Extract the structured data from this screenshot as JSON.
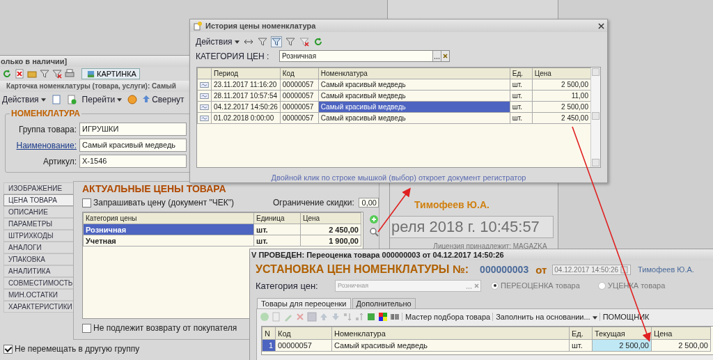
{
  "background_window": {
    "user": "Тимофеев Ю.А.",
    "clock": "реля 2018 г. 10:45:57",
    "license": "Лицензия принадлежит: MAGAZKA"
  },
  "item_window": {
    "title": "олько в наличии]",
    "picture_button": "КАРТИНКА",
    "card_title": "Карточка номенклатуры (товара, услуги): Самый",
    "menu": [
      {
        "label": "Действия",
        "kind": "dropdown"
      },
      {
        "label": "Перейти",
        "kind": "dropdown"
      },
      {
        "label": "Свернут",
        "kind": "link"
      }
    ],
    "group_title": "НОМЕНКЛАТУРА",
    "fields": [
      {
        "label": "Группа товара:",
        "value": "ИГРУШКИ",
        "link": false
      },
      {
        "label": "Наименование:",
        "value": "Самый красивый медведь",
        "link": true
      },
      {
        "label": "Артикул:",
        "value": "X-1546",
        "link": false
      }
    ],
    "tabs": [
      {
        "label": "ИЗОБРАЖЕНИЕ",
        "selected": false
      },
      {
        "label": "ЦЕНА ТОВАРА",
        "selected": true
      },
      {
        "label": "ОПИСАНИЕ",
        "selected": false
      },
      {
        "label": "ПАРАМЕТРЫ",
        "selected": false
      },
      {
        "label": "ШТРИХКОДЫ",
        "selected": false
      },
      {
        "label": "АНАЛОГИ",
        "selected": false
      },
      {
        "label": "УПАКОВКА",
        "selected": false
      },
      {
        "label": "АНАЛИТИКА",
        "selected": false
      },
      {
        "label": "СОВМЕСТИМОСТЬ",
        "selected": false
      },
      {
        "label": "МИН.ОСТАТКИ",
        "selected": false
      },
      {
        "label": "ХАРАКТЕРИСТИКИ",
        "selected": false
      }
    ],
    "prices_heading": "АКТУАЛЬНЫЕ ЦЕНЫ ТОВАРА",
    "ask_price": {
      "label": "Запрашивать цену (документ \"ЧЕК\")",
      "checked": false
    },
    "discount_limit": {
      "label": "Ограничение скидки:",
      "value": "0,00"
    },
    "price_table": {
      "columns": [
        "Категория цены",
        "Единица",
        "Цена"
      ],
      "rows": [
        {
          "cells": [
            "Розничная",
            "шт.",
            "2 450,00"
          ],
          "selected": true
        },
        {
          "cells": [
            "Учетная",
            "шт.",
            "1 900,00"
          ],
          "selected": false
        }
      ]
    },
    "no_return": {
      "label": "Не подлежит возврату от покупателя",
      "checked": false
    },
    "no_move": {
      "label": "Не перемещать в другую группу",
      "checked": true
    }
  },
  "history_window": {
    "title": "История цены номенклатура",
    "menu": "Действия",
    "category_label": "КАТЕГОРИЯ ЦЕН :",
    "category_value": "Розничная",
    "table": {
      "columns": [
        "Период",
        "Код",
        "Номенклатура",
        "Ед.",
        "Цена"
      ],
      "rows": [
        {
          "cells": [
            "23.11.2017 11:16:20",
            "00000057",
            "Самый красивый медведь",
            "шт.",
            "2 500,00"
          ],
          "selected": false
        },
        {
          "cells": [
            "28.11.2017 10:57:54",
            "00000057",
            "Самый красивый медведь",
            "шт.",
            "11,00"
          ],
          "selected": false
        },
        {
          "cells": [
            "04.12.2017 14:50:26",
            "00000057",
            "Самый красивый медведь",
            "шт.",
            "2 500,00"
          ],
          "selected": true
        },
        {
          "cells": [
            "01.02.2018 0:00:00",
            "00000057",
            "Самый красивый медведь",
            "шт.",
            "2 450,00"
          ],
          "selected": false
        }
      ]
    },
    "hint": "Двойной клик по строке мышкой (выбор) откроет документ регистратор"
  },
  "document_window": {
    "title": "V ПРОВЕДЕН: Переоценка товара 000000003 от 04.12.2017 14:50:26",
    "heading": "УСТАНОВКА ЦЕН НОМЕНКЛАТУРЫ №:",
    "number": "000000003",
    "from": "от",
    "date": "04.12.2017 14:50:26",
    "author": "Тимофеев Ю.А.",
    "category_label": "Категория цен:",
    "category_value": "Розничная",
    "modes": [
      {
        "label": "ПЕРЕОЦЕНКА товара",
        "selected": true
      },
      {
        "label": "УЦЕНКА товара",
        "selected": false
      }
    ],
    "tabs": [
      {
        "label": "Товары для переоценки",
        "selected": true
      },
      {
        "label": "Дополнительно",
        "selected": false
      }
    ],
    "toolbar": [
      {
        "label": "Мастер подбора товара",
        "dropdown": false
      },
      {
        "label": "Заполнить на основании...",
        "dropdown": true
      },
      {
        "label": "ПОМОЩНИК",
        "dropdown": false
      }
    ],
    "table": {
      "columns": [
        "N",
        "Код",
        "Номенклатура",
        "Ед.",
        "Текущая",
        "Цена"
      ],
      "rows": [
        {
          "cells": [
            "1",
            "00000057",
            "Самый красивый медведь",
            "шт.",
            "2 500,00",
            "2 500,00"
          ]
        }
      ]
    }
  }
}
